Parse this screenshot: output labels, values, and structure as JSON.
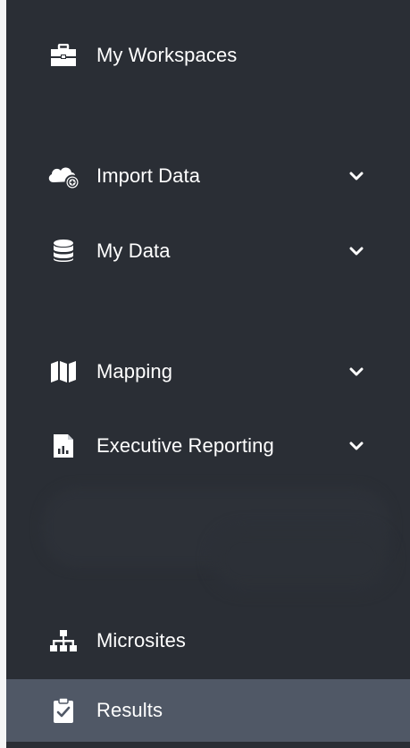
{
  "sidebar": {
    "items": [
      {
        "label": "My Workspaces",
        "icon": "briefcase-icon",
        "has_chevron": false
      },
      {
        "label": "Import Data",
        "icon": "cloud-upload-icon",
        "has_chevron": true
      },
      {
        "label": "My Data",
        "icon": "database-icon",
        "has_chevron": true
      },
      {
        "label": "Mapping",
        "icon": "map-icon",
        "has_chevron": true
      },
      {
        "label": "Executive Reporting",
        "icon": "report-icon",
        "has_chevron": true
      },
      {
        "label": "Microsites",
        "icon": "sitemap-icon",
        "has_chevron": false
      },
      {
        "label": "Results",
        "icon": "clipboard-check-icon",
        "has_chevron": false,
        "active": true
      }
    ]
  },
  "colors": {
    "sidebar_bg": "#2a2e35",
    "active_bg": "#505866",
    "text": "#ffffff"
  }
}
